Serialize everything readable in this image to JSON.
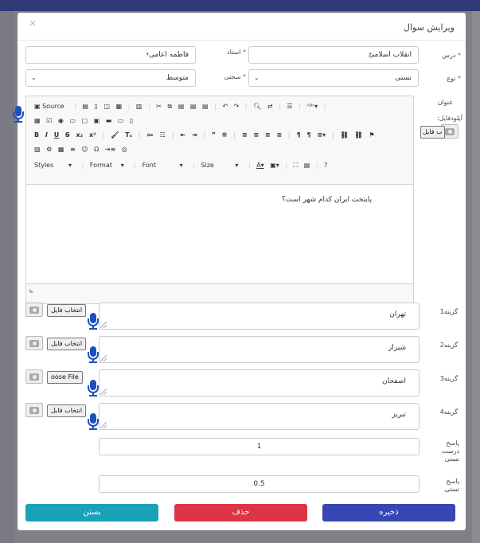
{
  "dialog": {
    "title": "ویرایش سوال",
    "close_glyph": "×"
  },
  "form": {
    "course_label": "درس",
    "course_value": "انقلاب اسلامی",
    "teacher_label": "استاد",
    "teacher_value": "فاطمه اعامی",
    "type_label": "نوع",
    "type_value": "تستی",
    "difficulty_label": "سختی",
    "difficulty_value": "متوسط",
    "required_mark": "*",
    "title_label": "عنوان",
    "upload_label": "آپلودفایل:",
    "upload_btn_short": "ب فایل"
  },
  "editor": {
    "toolbar_row1": [
      "Source",
      "|",
      "💾",
      "🗋",
      "🔍",
      "🖶",
      "|",
      "✂",
      "⧉",
      "📋",
      "📋",
      "📋",
      "|",
      "↶",
      "↷",
      "|",
      "🔍",
      "⇄",
      "|",
      "☰",
      "|",
      "ABC▾",
      "|"
    ],
    "toolbar_row2": [
      "▦",
      "☑",
      "◉",
      "▭",
      "▢",
      "▣",
      "▬",
      "▭",
      "🗋"
    ],
    "toolbar_row3": [
      "B",
      "I",
      "U",
      "S",
      "x₂",
      "x²",
      "|",
      "🖌",
      "Tₓ",
      "|",
      "1≡",
      "•≡",
      "|",
      "⇤",
      "⇥",
      "|",
      "❞",
      "⁜",
      "|",
      "≡",
      "≡",
      "≡",
      "≡",
      "|",
      "¶",
      "¶",
      "≡▾",
      "|",
      "⛓",
      "⛓",
      "⚑"
    ],
    "toolbar_row4": [
      "🖼",
      "⚙",
      "▦",
      "≡",
      "☺",
      "Ω",
      "⇥≡",
      "◎"
    ],
    "toolbar_row5": [
      "Styles",
      "▾",
      "|",
      "Format",
      "▾",
      "|",
      "Font",
      "▾",
      "|",
      "Size",
      "▾",
      "|",
      "A▾",
      "A▾",
      "|",
      "⛶",
      "▤",
      "|",
      "?"
    ],
    "content": "پایتخت ایران کدام شهر است؟",
    "footer_glyph": "◣"
  },
  "options": [
    {
      "label": "گزینه1",
      "value": "تهران",
      "file_btn": "انتخاب فایل"
    },
    {
      "label": "گزینه2",
      "value": "شیراز",
      "file_btn": "انتخاب فایل"
    },
    {
      "label": "گزینه3",
      "value": "اصفحان",
      "file_btn": "oose File"
    },
    {
      "label": "گزینه4",
      "value": "تبریز",
      "file_btn": "انتخاب فایل"
    }
  ],
  "answers": {
    "correct_label_1": "پاسخ",
    "correct_label_2": "درست",
    "correct_label_3": "تستی",
    "correct_value": "1",
    "answer_label_1": "پاسخ",
    "answer_label_2": "تستی",
    "answer_value": "0.5"
  },
  "buttons": {
    "save": "ذخیره",
    "delete": "حذف",
    "close": "بستن"
  },
  "colors": {
    "save": "#3647b3",
    "delete": "#dc3545",
    "close": "#17a2b8",
    "mic": "#1e4fbf"
  }
}
